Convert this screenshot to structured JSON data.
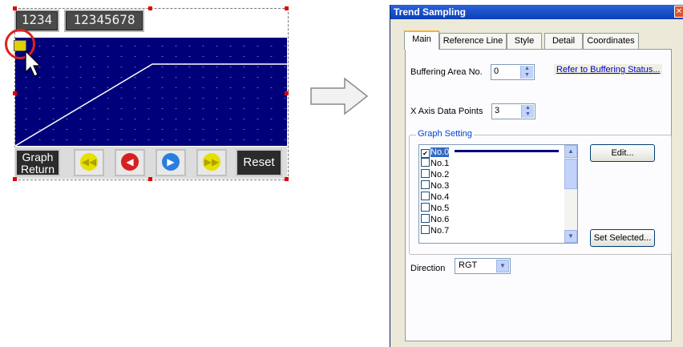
{
  "editor": {
    "lcd1": "1234",
    "lcd2": "12345678",
    "buttons": {
      "graph_return_line1": "Graph",
      "graph_return_line2": "Return",
      "reset": "Reset"
    },
    "colors": {
      "graph_bg": "#00007a",
      "btn_yellow": "#e5e000",
      "btn_red": "#d82020",
      "btn_blue": "#2a7de0"
    }
  },
  "dialog": {
    "title": "Trend Sampling",
    "close_glyph": "✕",
    "tabs": [
      "Main",
      "Reference Line",
      "Style",
      "Detail",
      "Coordinates"
    ],
    "active_tab": "Main",
    "buffering_area_label": "Buffering Area No.",
    "buffering_area_value": "0",
    "buffer_link": "Refer to Buffering Status...",
    "x_axis_label": "X Axis Data Points",
    "x_axis_value": "3",
    "graph_setting_label": "Graph Setting",
    "graph_items": [
      {
        "label": "No.0",
        "checked": true
      },
      {
        "label": "No.1",
        "checked": false
      },
      {
        "label": "No.2",
        "checked": false
      },
      {
        "label": "No.3",
        "checked": false
      },
      {
        "label": "No.4",
        "checked": false
      },
      {
        "label": "No.5",
        "checked": false
      },
      {
        "label": "No.6",
        "checked": false
      },
      {
        "label": "No.7",
        "checked": false
      }
    ],
    "edit_button": "Edit...",
    "set_selected_button": "Set Selected...",
    "direction_label": "Direction",
    "direction_value": "RGT"
  }
}
